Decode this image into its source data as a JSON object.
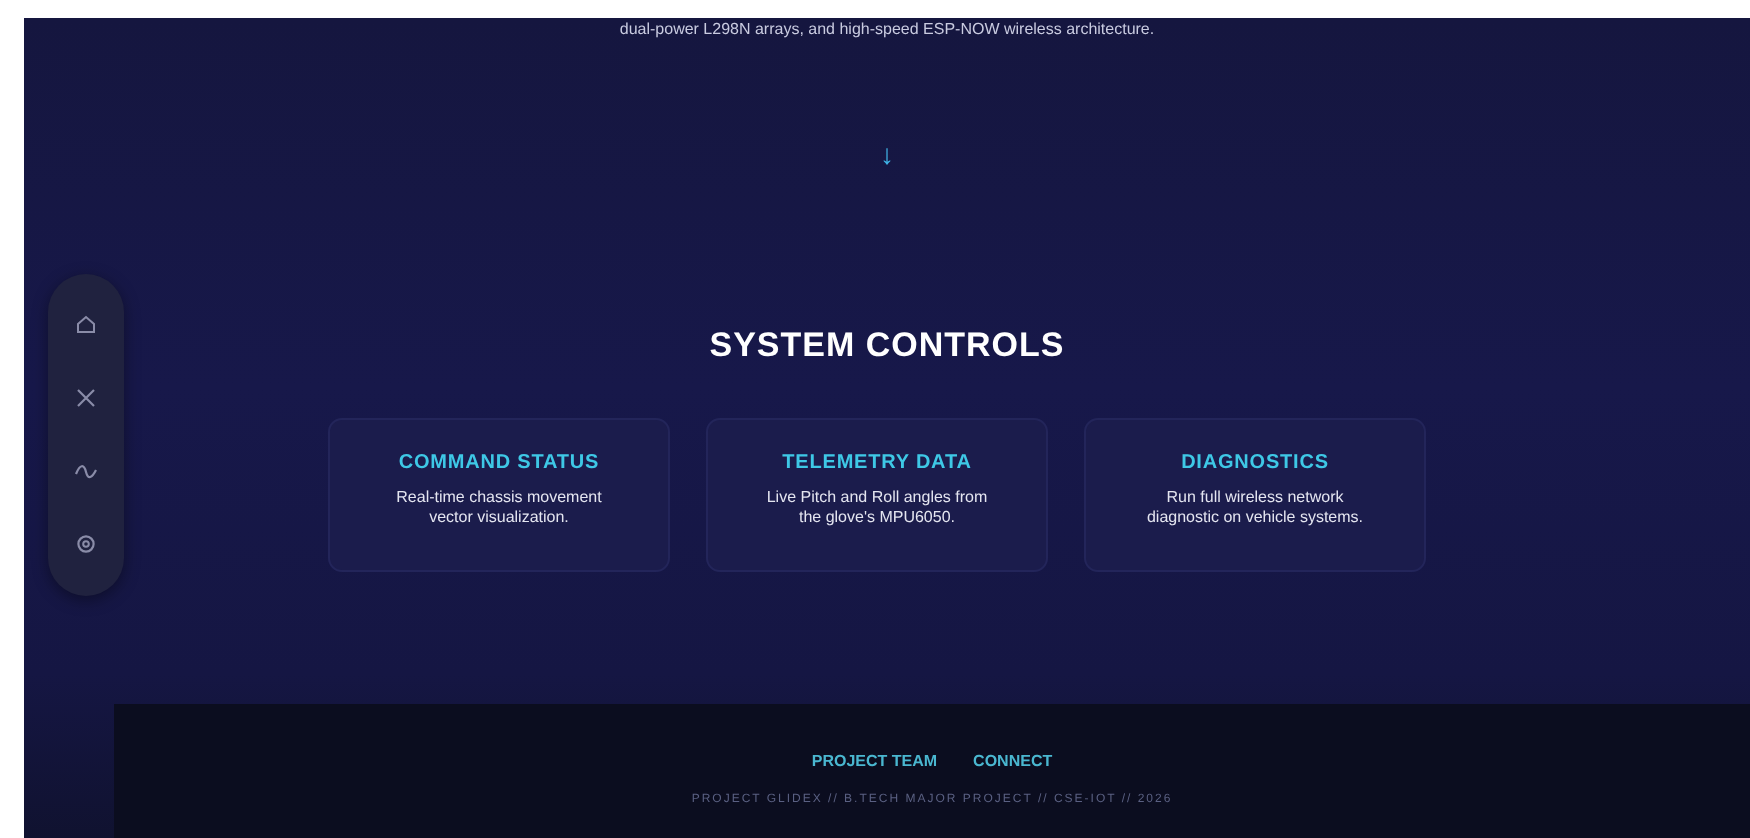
{
  "intro": {
    "text": "dual-power L298N arrays, and high-speed ESP-NOW wireless architecture.",
    "scroll_arrow": "↓"
  },
  "sidebar": {
    "items": [
      {
        "kind": "home"
      },
      {
        "kind": "close"
      },
      {
        "kind": "wave"
      },
      {
        "kind": "settings"
      }
    ]
  },
  "section": {
    "title": "SYSTEM CONTROLS",
    "cards": [
      {
        "title": "COMMAND STATUS",
        "text": "Real-time chassis movement vector visualization."
      },
      {
        "title": "TELEMETRY DATA",
        "text": "Live Pitch and Roll angles from the glove's MPU6050."
      },
      {
        "title": "DIAGNOSTICS",
        "text": "Run full wireless network diagnostic on vehicle systems."
      }
    ]
  },
  "footer": {
    "links": [
      "PROJECT TEAM",
      "CONNECT"
    ],
    "copyright": "PROJECT GLIDEX // B.TECH MAJOR PROJECT // CSE-IOT // 2026"
  }
}
